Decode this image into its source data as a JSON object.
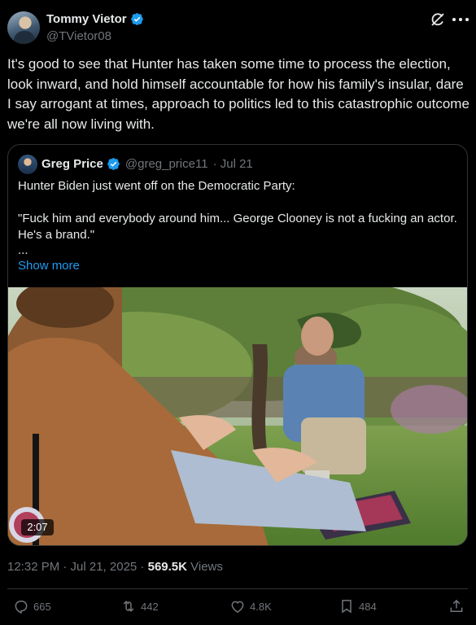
{
  "author": {
    "display_name": "Tommy Vietor",
    "handle": "@TVietor08",
    "verified": true
  },
  "icons": {
    "verified": "verified-badge-icon",
    "grok": "grok-icon",
    "more": "more-icon",
    "reply": "reply-icon",
    "repost": "repost-icon",
    "like": "heart-icon",
    "bookmark": "bookmark-icon",
    "share": "share-icon"
  },
  "tweet": {
    "text": "It's good to see that Hunter has taken some time to process the election, look inward, and hold himself accountable for how his family's insular, dare I say arrogant at times, approach to politics led to this catastrophic outcome we're all now living with."
  },
  "quote": {
    "display_name": "Greg Price",
    "handle": "@greg_price11",
    "date": "· Jul 21",
    "line1": "Hunter Biden just went off on the Democratic Party:",
    "line2": "\"Fuck him and everybody around him... George Clooney is not a fucking an actor. He's a brand.\"",
    "ellipsis": "...",
    "show_more": "Show more",
    "video_duration": "2:07"
  },
  "meta": {
    "timestamp": "12:32 PM · Jul 21, 2025 · ",
    "views_count": "569.5K",
    "views_label": " Views"
  },
  "actions": {
    "replies": "665",
    "reposts": "442",
    "likes": "4.8K",
    "bookmarks": "484"
  },
  "colors": {
    "background": "#000000",
    "text": "#e7e9ea",
    "secondary": "#71767b",
    "accent": "#1d9bf0",
    "border": "#2f3336"
  }
}
